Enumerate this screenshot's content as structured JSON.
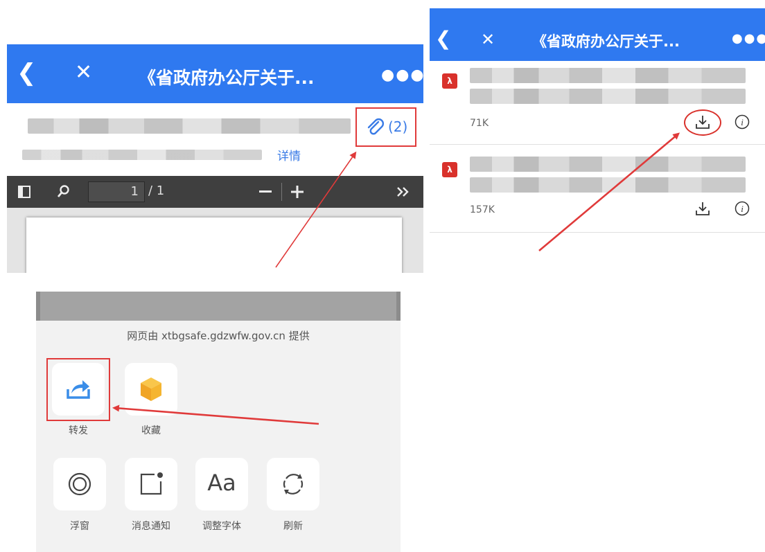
{
  "viewer": {
    "nav": {
      "back_icon": "chevron-left-icon",
      "close_icon": "close-icon",
      "title": "《省政府办公厅关于...",
      "more_icon": "more-dots-icon"
    },
    "detail_link": "详情",
    "attachment_count": "(2)",
    "pdf_toolbar": {
      "page_current": "1",
      "page_total": "/ 1"
    }
  },
  "share_sheet": {
    "provider": "网页由 xtbgsafe.gdzwfw.gov.cn 提供",
    "row1": [
      {
        "label": "转发",
        "icon": "share-forward-icon"
      },
      {
        "label": "收藏",
        "icon": "favorite-cube-icon"
      }
    ],
    "row2": [
      {
        "label": "浮窗",
        "icon": "float-window-icon"
      },
      {
        "label": "消息通知",
        "icon": "notification-icon"
      },
      {
        "label": "调整字体",
        "icon": "font-size-icon",
        "glyph": "Aa"
      },
      {
        "label": "刷新",
        "icon": "refresh-icon"
      }
    ]
  },
  "attachments": {
    "nav": {
      "title": "《省政府办公厅关于..."
    },
    "items": [
      {
        "size": "71K"
      },
      {
        "size": "157K"
      }
    ]
  },
  "colors": {
    "nav_blue": "#2f79f0",
    "link_blue": "#3a7be6",
    "annotation_red": "#e03a3a",
    "pdf_red": "#d9312b"
  }
}
